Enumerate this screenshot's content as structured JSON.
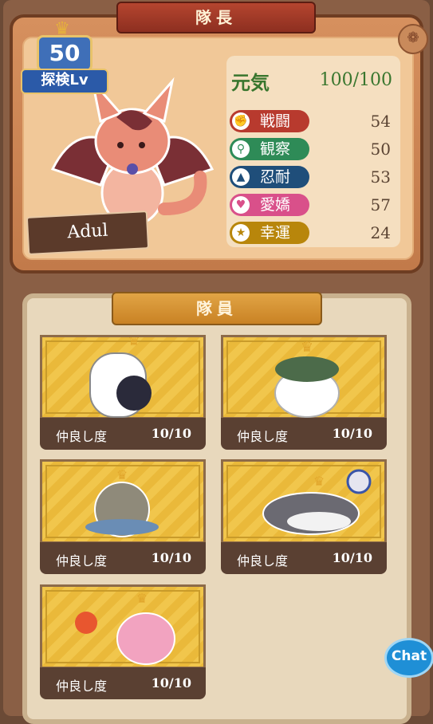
{
  "leader_panel": {
    "title": "隊長",
    "level": "50",
    "level_label": "探検Lv",
    "name": "Adul",
    "stamina": {
      "label": "元気",
      "value": "100/100"
    },
    "stats": [
      {
        "label": "戦闘",
        "value": "54",
        "color": "#c0392b",
        "icon": "fist-icon"
      },
      {
        "label": "観察",
        "value": "50",
        "color": "#2e8b57",
        "icon": "magnifier-icon"
      },
      {
        "label": "忍耐",
        "value": "53",
        "color": "#1f4e7a",
        "icon": "flame-icon"
      },
      {
        "label": "愛嬌",
        "value": "57",
        "color": "#d9508a",
        "icon": "heart-icon"
      },
      {
        "label": "幸運",
        "value": "24",
        "color": "#b8860b",
        "icon": "star-icon"
      }
    ]
  },
  "members_panel": {
    "title": "隊員",
    "members": [
      {
        "label": "仲良し度",
        "value": "10/10",
        "creature": "robot"
      },
      {
        "label": "仲良し度",
        "value": "10/10",
        "creature": "bird"
      },
      {
        "label": "仲良し度",
        "value": "10/10",
        "creature": "cat"
      },
      {
        "label": "仲良し度",
        "value": "10/10",
        "creature": "shark"
      },
      {
        "label": "仲良し度",
        "value": "10/10",
        "creature": "dragon"
      }
    ]
  },
  "chat_button": {
    "label": "Chat"
  }
}
